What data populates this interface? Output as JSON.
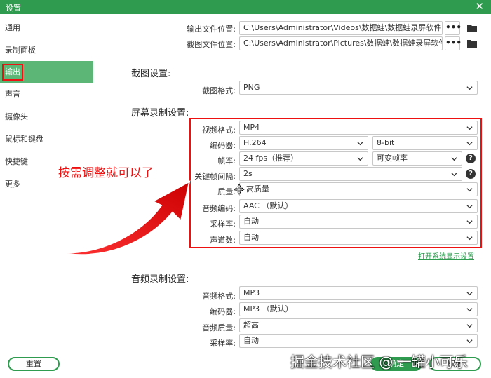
{
  "window": {
    "title": "设置",
    "close_glyph": "✕"
  },
  "sidebar": {
    "items": [
      {
        "label": "通用"
      },
      {
        "label": "录制面板"
      },
      {
        "label": "输出"
      },
      {
        "label": "声音"
      },
      {
        "label": "摄像头"
      },
      {
        "label": "鼠标和键盘"
      },
      {
        "label": "快捷键"
      },
      {
        "label": "更多"
      }
    ]
  },
  "output": {
    "video_folder_label": "输出文件位置:",
    "video_folder_value": "C:\\Users\\Administrator\\Videos\\数据蛙\\数据蛙录屏软件",
    "screenshot_folder_label": "截图文件位置:",
    "screenshot_folder_value": "C:\\Users\\Administrator\\Pictures\\数据蛙\\数据蛙录屏软件",
    "more_glyph": "•••"
  },
  "screenshot_settings": {
    "title": "截图设置:",
    "format_label": "截图格式:",
    "format_value": "PNG"
  },
  "screen_settings": {
    "title": "屏幕录制设置:",
    "video_format_label": "视频格式:",
    "video_format_value": "MP4",
    "encoder_label": "编码器:",
    "encoder_value": "H.264",
    "bitdepth_value": "8-bit",
    "framerate_label": "帧率:",
    "framerate_value": "24 fps（推荐）",
    "framerate_mode_value": "可变帧率",
    "keyframe_label": "关键帧间隔:",
    "keyframe_value": "2s",
    "quality_label": "质量:",
    "quality_value": "高质量",
    "audio_codec_label": "音频编码:",
    "audio_codec_value": "AAC （默认）",
    "samplerate_label": "采样率:",
    "samplerate_value": "自动",
    "channels_label": "声道数:",
    "channels_value": "自动",
    "display_link": "打开系统显示设置",
    "help_glyph": "?"
  },
  "audio_settings": {
    "title": "音频录制设置:",
    "format_label": "音频格式:",
    "format_value": "MP3",
    "encoder_label": "编码器:",
    "encoder_value": "MP3 （默认）",
    "quality_label": "音频质量:",
    "quality_value": "超高",
    "samplerate_label": "采样率:",
    "samplerate_value": "自动"
  },
  "annotation": {
    "text": "按需调整就可以了"
  },
  "footer": {
    "reset_label": "重置",
    "ok_label": "确定",
    "cancel_label": "取消",
    "watermark": "掘金技术社区 @ 一罐小可乐"
  },
  "colors": {
    "accent": "#2e9b4f",
    "sidebar_active": "#5cb776",
    "annotation_red": "#e11"
  }
}
